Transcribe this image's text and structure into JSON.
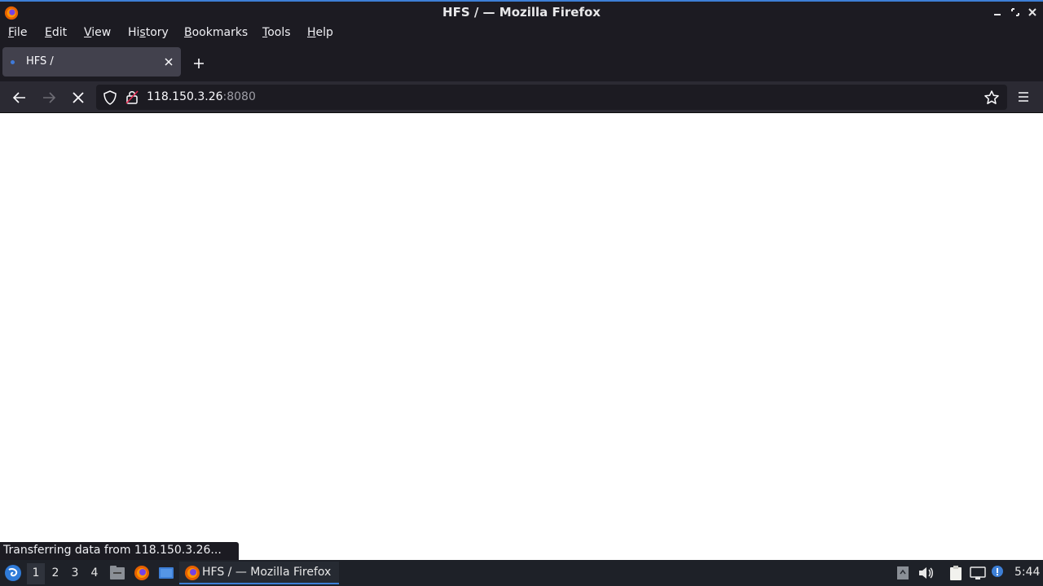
{
  "window": {
    "title": "HFS / — Mozilla Firefox",
    "accent_color": "#3d7fd6"
  },
  "menubar": {
    "items": [
      {
        "label_acc": "F",
        "label_rest": "ile"
      },
      {
        "label_acc": "E",
        "label_rest": "dit"
      },
      {
        "label_acc": "V",
        "label_rest": "iew"
      },
      {
        "label_pre": "Hi",
        "label_acc": "s",
        "label_rest": "tory"
      },
      {
        "label_acc": "B",
        "label_rest": "ookmarks"
      },
      {
        "label_acc": "T",
        "label_rest": "ools"
      },
      {
        "label_acc": "H",
        "label_rest": "elp"
      }
    ]
  },
  "tabs": [
    {
      "title": "HFS /",
      "icon": "loading-dot-icon"
    }
  ],
  "navbar": {
    "url_host": "118.150.3.26",
    "url_port": ":8080",
    "back_icon": "back-arrow-icon",
    "forward_icon": "forward-arrow-icon",
    "stop_icon": "stop-x-icon"
  },
  "status": {
    "text": "Transferring data from 118.150.3.26..."
  },
  "taskbar": {
    "workspaces": [
      "1",
      "2",
      "3",
      "4"
    ],
    "active_workspace": "1",
    "task_label": "HFS / — Mozilla Firefox",
    "clock": "5:44"
  }
}
